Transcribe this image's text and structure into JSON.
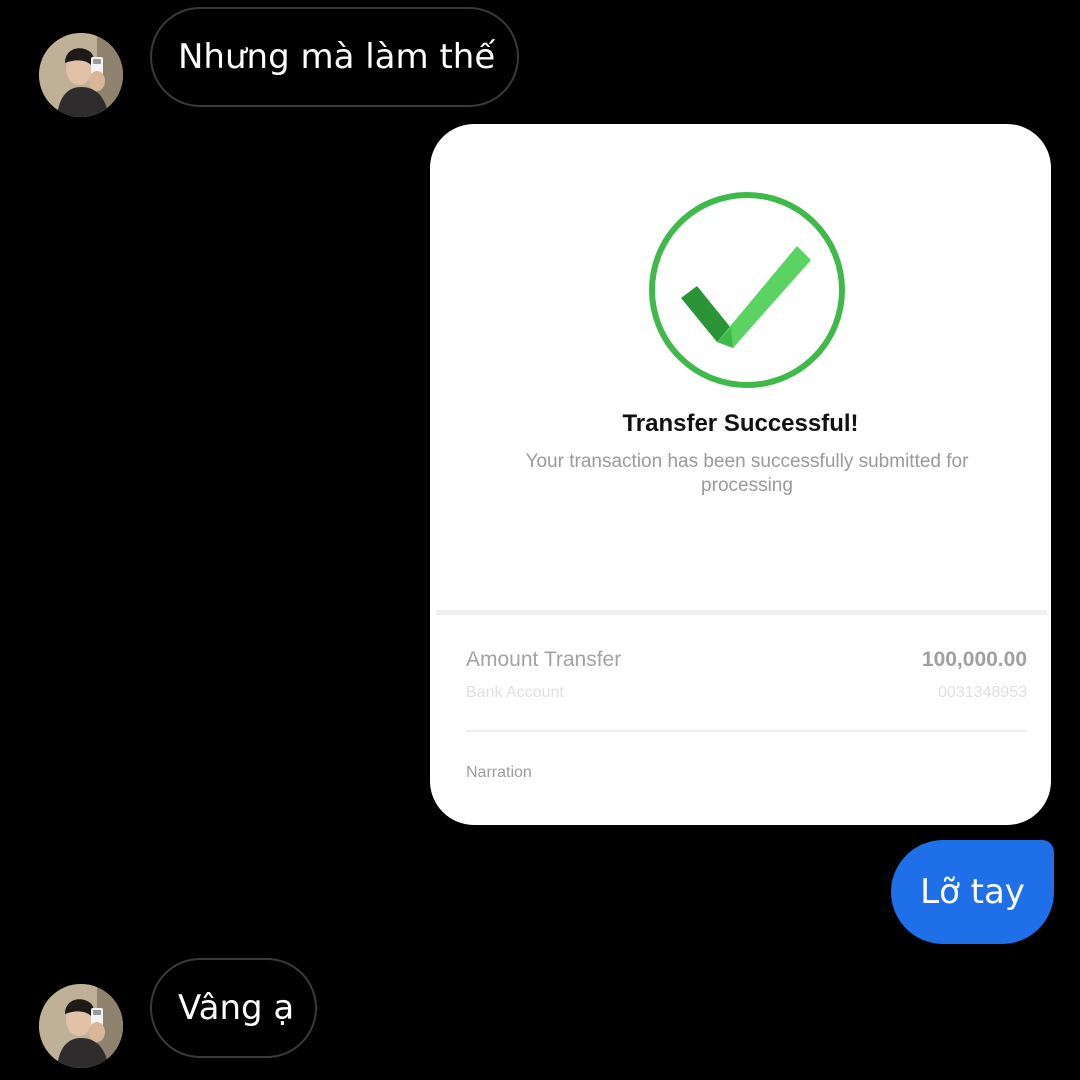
{
  "conversation": {
    "messages": [
      {
        "sender": "other",
        "text": "Nhưng mà làm thế"
      },
      {
        "sender": "me",
        "type": "image"
      },
      {
        "sender": "me",
        "text": "Lỡ tay"
      },
      {
        "sender": "other",
        "text": "Vâng ạ"
      }
    ]
  },
  "transfer_card": {
    "icon": "check-circle-icon",
    "title": "Transfer Successful!",
    "subtitle": "Your transaction has been successfully submitted for processing",
    "amount_label": "Amount Transfer",
    "amount_value": "100,000.00",
    "bank_label": "Bank Account",
    "bank_value": "0031348953",
    "narration_label": "Narration"
  },
  "colors": {
    "background": "#000000",
    "outgoing_bubble": "#1f6fe8",
    "incoming_bubble_border": "#3a3a3a",
    "success_green": "#3fba4a",
    "card_background": "#ffffff"
  }
}
